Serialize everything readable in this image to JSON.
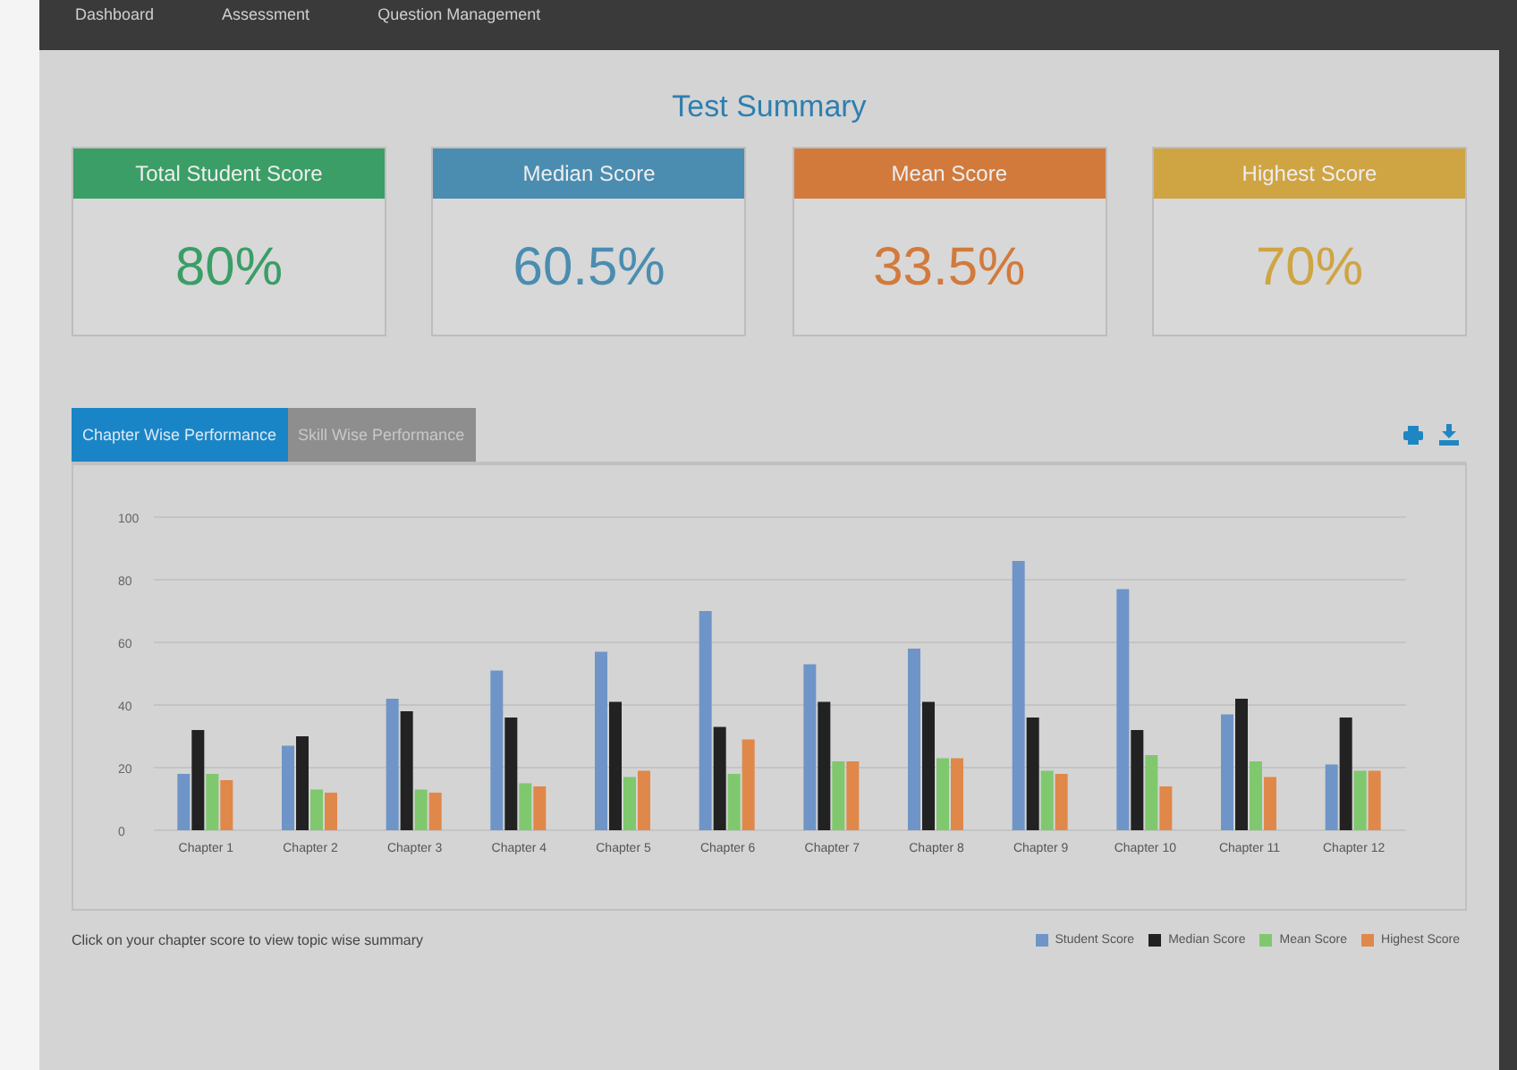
{
  "nav": {
    "items": [
      {
        "label": "Dashboard"
      },
      {
        "label": "Assessment"
      },
      {
        "label": "Question Management"
      }
    ]
  },
  "title": "Test Summary",
  "cards": [
    {
      "label": "Total Student Score",
      "value": "80%",
      "color": "#3a9e66"
    },
    {
      "label": "Median Score",
      "value": "60.5%",
      "color": "#4a8db0"
    },
    {
      "label": "Mean Score",
      "value": "33.5%",
      "color": "#d27a3c"
    },
    {
      "label": "Highest Score",
      "value": "70%",
      "color": "#cfa443"
    }
  ],
  "tabs": [
    {
      "label": "Chapter Wise Performance",
      "selected": true
    },
    {
      "label": "Skill Wise Performance",
      "selected": false
    }
  ],
  "chart_data": {
    "type": "bar",
    "categories": [
      "Chapter 1",
      "Chapter 2",
      "Chapter 3",
      "Chapter 4",
      "Chapter 5",
      "Chapter 6",
      "Chapter 7",
      "Chapter 8",
      "Chapter 9",
      "Chapter 10",
      "Chapter 11",
      "Chapter 12"
    ],
    "ylim": [
      0,
      100
    ],
    "grid": true,
    "yticks": [
      0,
      20,
      40,
      60,
      80,
      100
    ],
    "series": [
      {
        "name": "Student Score",
        "color": "#6f95c8",
        "values": [
          18,
          27,
          42,
          51,
          57,
          70,
          53,
          58,
          86,
          77,
          37,
          21
        ]
      },
      {
        "name": "Median Score",
        "color": "#222222",
        "values": [
          32,
          30,
          38,
          36,
          41,
          33,
          41,
          41,
          36,
          32,
          42,
          36
        ]
      },
      {
        "name": "Mean Score",
        "color": "#7fc86e",
        "values": [
          18,
          13,
          13,
          15,
          17,
          18,
          22,
          23,
          19,
          24,
          22,
          19
        ]
      },
      {
        "name": "Highest Score",
        "color": "#e0884a",
        "values": [
          16,
          12,
          12,
          14,
          19,
          29,
          22,
          23,
          18,
          14,
          17,
          19
        ]
      }
    ]
  },
  "hint": "Click on your chapter score to view topic wise summary"
}
